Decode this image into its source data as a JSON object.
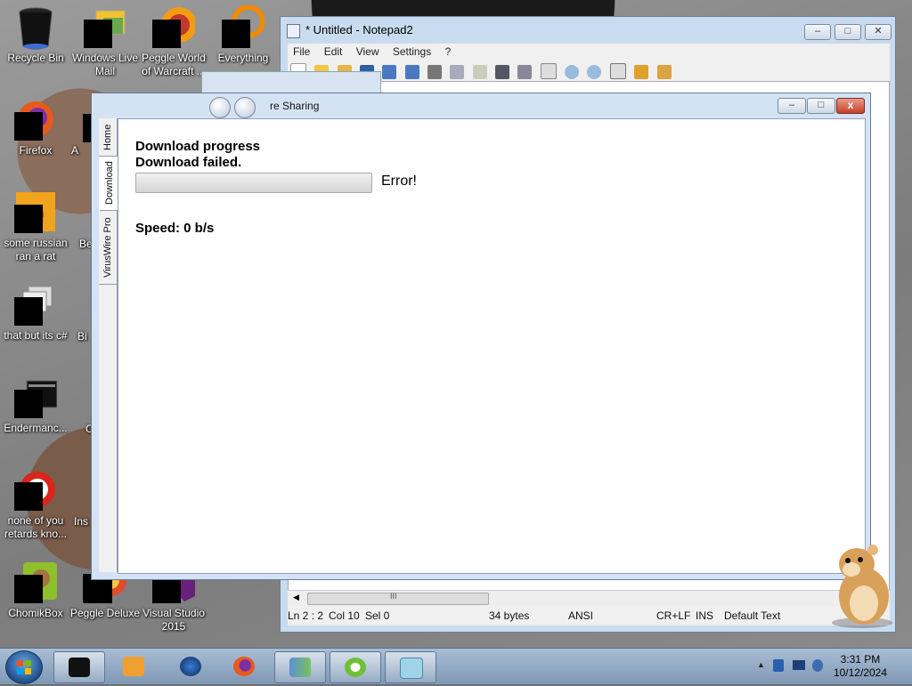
{
  "desktop": {
    "icons": [
      {
        "label": "Recycle Bin"
      },
      {
        "label": "Windows Live Mail"
      },
      {
        "label": "Peggle World of Warcraft ..."
      },
      {
        "label": "Everything"
      },
      {
        "label": "Firefox"
      },
      {
        "label": "some russian ran a rat"
      },
      {
        "label": "that but its c#"
      },
      {
        "label": "Endermanc..."
      },
      {
        "label": "none of you retards kno..."
      },
      {
        "label": "ChomikBox"
      },
      {
        "label": "Peggle Deluxe"
      },
      {
        "label": "Visual Studio 2015"
      }
    ],
    "partial_labels": [
      "A",
      "Be",
      "Bi",
      "C",
      "Ins"
    ]
  },
  "notepad": {
    "title": "* Untitled - Notepad2",
    "menu": [
      "File",
      "Edit",
      "View",
      "Settings",
      "?"
    ],
    "status": {
      "position": "Ln 2 : 2",
      "col": "Col 10",
      "sel": "Sel 0",
      "size": "34 bytes",
      "encoding": "ANSI",
      "eol": "CR+LF",
      "mode": "INS",
      "scheme": "Default Text"
    },
    "hscroll_grip": "III"
  },
  "main_window": {
    "title": "re Sharing",
    "tabs": [
      "Home",
      "Download",
      "VirusWire Pro"
    ],
    "active_tab": "Download",
    "heading": "Download progress",
    "status_text": "Download failed.",
    "progress_fraction": 0,
    "progress_label": "Error!",
    "speed": "Speed: 0 b/s",
    "close_glyph": "x"
  },
  "taskbar": {
    "time": "3:31 PM",
    "date": "10/12/2024",
    "tray_arrow": "▲"
  },
  "colors": {
    "error_red": "#c5402a",
    "window_frame": "#d4e3f3",
    "progress_fill": "#3cb43c"
  }
}
